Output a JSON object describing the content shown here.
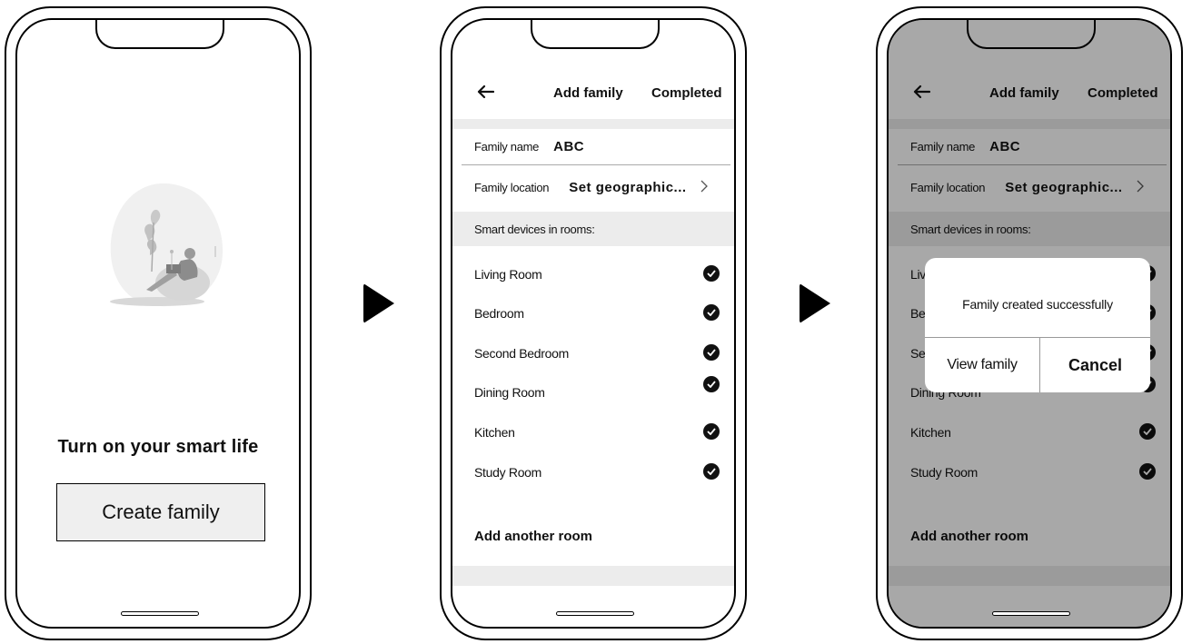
{
  "screen1": {
    "tagline": "Turn on your smart life",
    "create_button": "Create family",
    "illustration": "person-on-beanbag-illustration"
  },
  "add_family": {
    "back_icon": "back-arrow-icon",
    "title": "Add family",
    "done": "Completed",
    "family_name_label": "Family name",
    "family_name_value": "ABC",
    "family_location_label": "Family location",
    "family_location_value": "Set geographic...",
    "rooms_header": "Smart devices in rooms:",
    "rooms": [
      {
        "name": "Living Room",
        "checked": true
      },
      {
        "name": "Bedroom",
        "checked": true
      },
      {
        "name": "Second Bedroom",
        "checked": true
      },
      {
        "name": "Dining Room",
        "checked": true
      },
      {
        "name": "Kitchen",
        "checked": true
      },
      {
        "name": "Study Room",
        "checked": true
      }
    ],
    "add_room": "Add another room"
  },
  "dialog": {
    "message": "Family created successfully",
    "view_button": "View family",
    "cancel_button": "Cancel"
  },
  "colors": {
    "strip": "#ececec",
    "overlay": "#a8a8a8",
    "ink": "#111111"
  }
}
